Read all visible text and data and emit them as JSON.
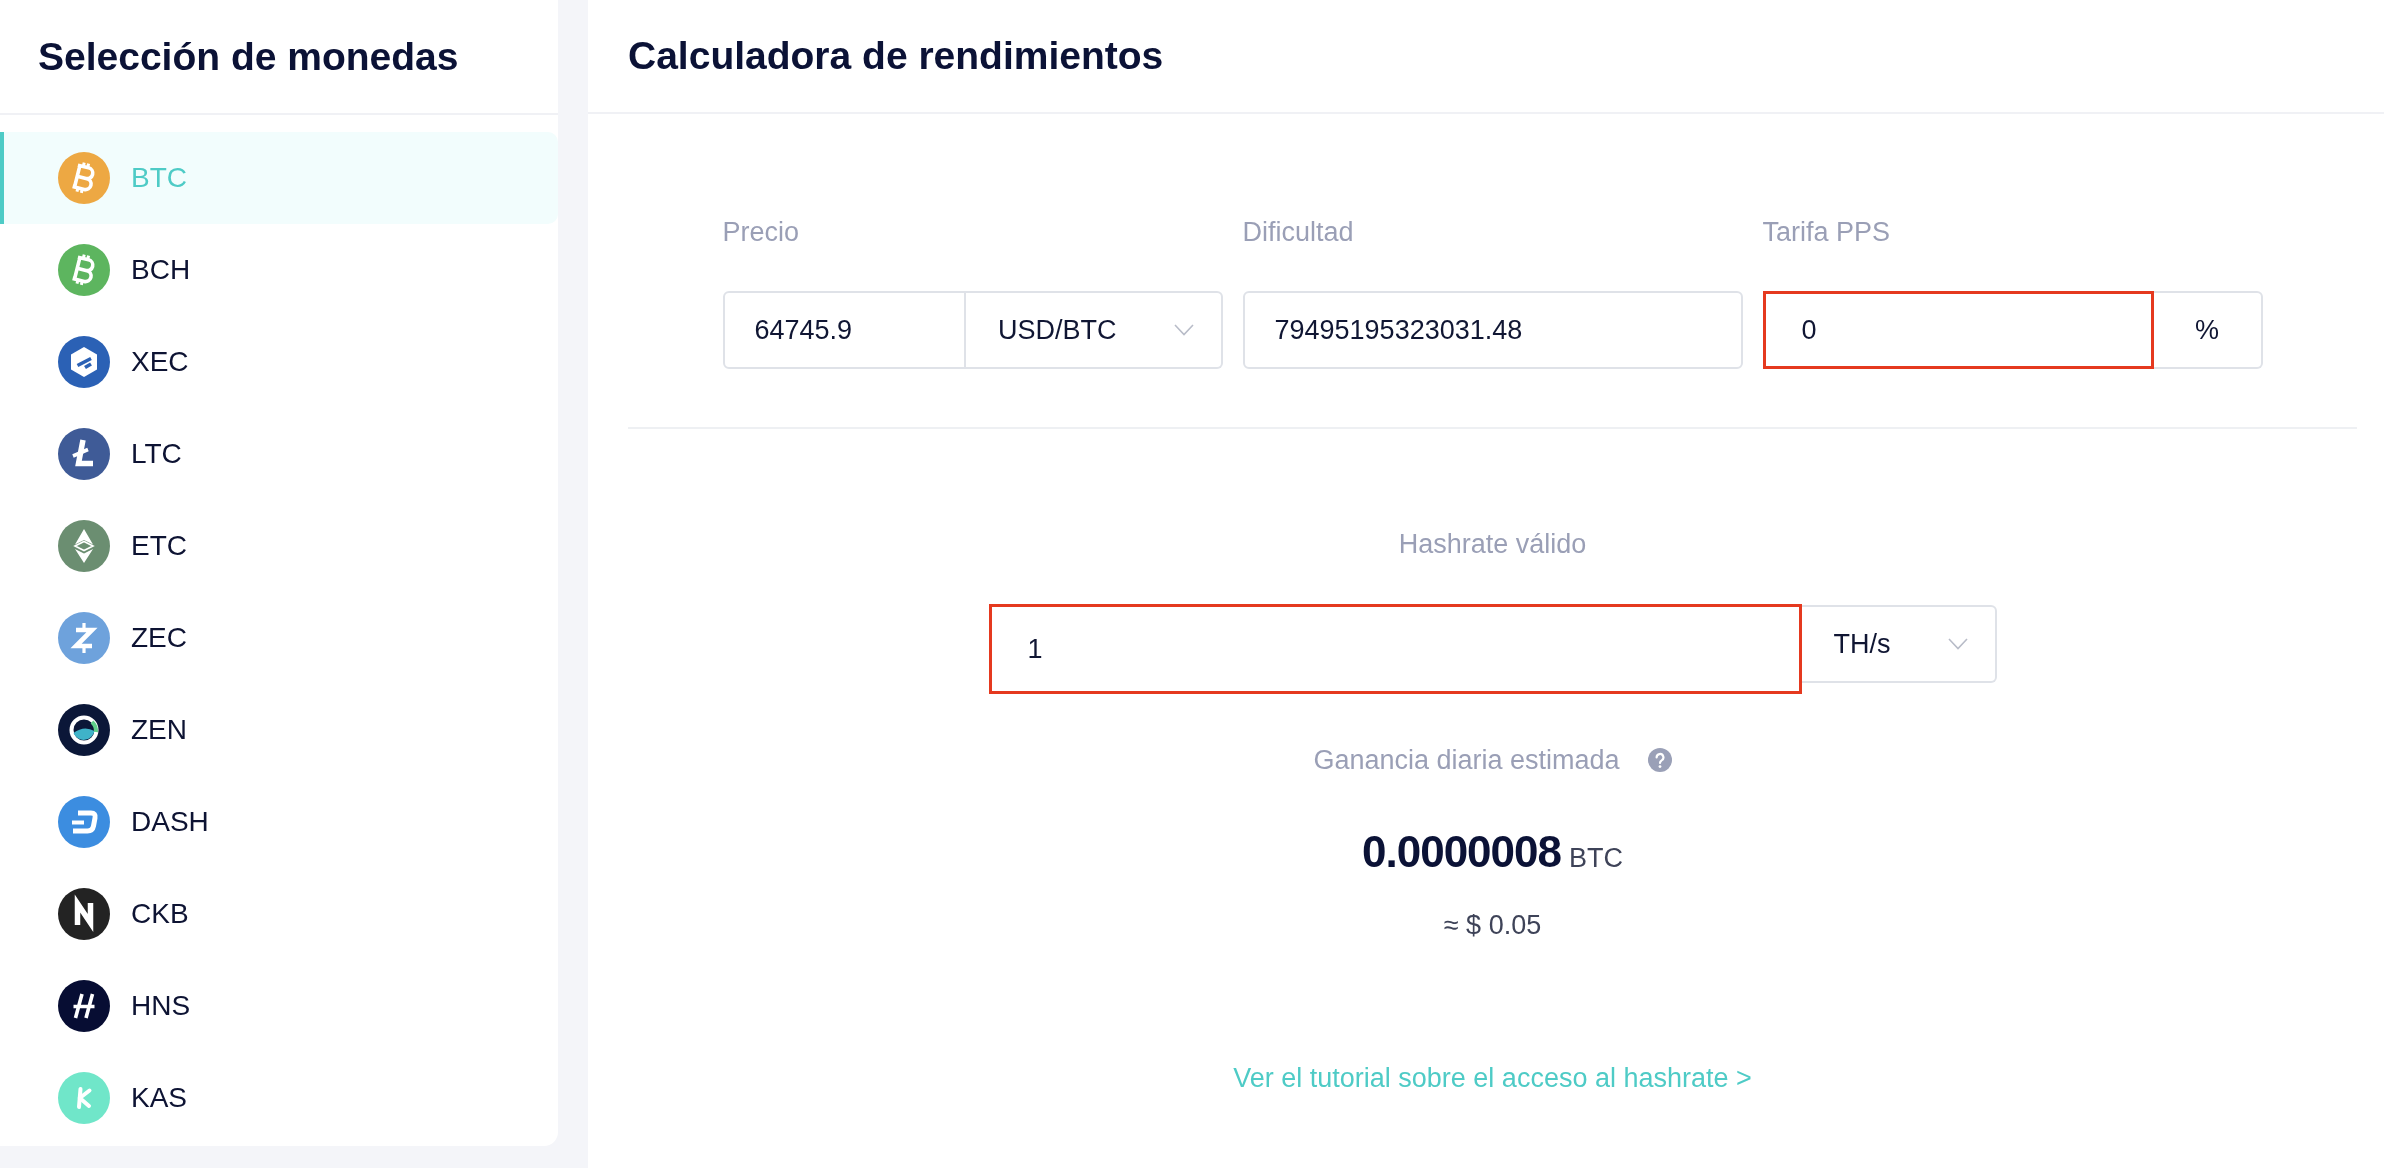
{
  "sidebar": {
    "title": "Selección de monedas",
    "coins": [
      {
        "label": "BTC",
        "selected": true,
        "kind": "b-sign",
        "color": "#eda843"
      },
      {
        "label": "BCH",
        "selected": false,
        "kind": "b-sign",
        "color": "#5db55f"
      },
      {
        "label": "XEC",
        "selected": false,
        "kind": "e-hexagon",
        "color": "#2b61b5"
      },
      {
        "label": "LTC",
        "selected": false,
        "kind": "l-sign",
        "color": "#3f5b97"
      },
      {
        "label": "ETC",
        "selected": false,
        "kind": "diamond",
        "color": "#6b8e71"
      },
      {
        "label": "ZEC",
        "selected": false,
        "kind": "z-sign",
        "color": "#6ea2dc"
      },
      {
        "label": "ZEN",
        "selected": false,
        "kind": "ring",
        "color": "#0b1738"
      },
      {
        "label": "DASH",
        "selected": false,
        "kind": "d-sign",
        "color": "#3c8de0"
      },
      {
        "label": "CKB",
        "selected": false,
        "kind": "n-block",
        "color": "#232323"
      },
      {
        "label": "HNS",
        "selected": false,
        "kind": "h-block",
        "color": "#070d33"
      },
      {
        "label": "KAS",
        "selected": false,
        "kind": "k-sign",
        "color": "#70e6c9"
      }
    ]
  },
  "calculator": {
    "title": "Calculadora de rendimientos",
    "fields": [
      {
        "label": "Precio",
        "value": "64745.9",
        "unit": "USD/BTC",
        "kind": "with-select",
        "highlighted": false
      },
      {
        "label": "Dificultad",
        "value": "79495195323031.48",
        "kind": "plain",
        "highlighted": false
      },
      {
        "label": "Tarifa PPS",
        "value": "0",
        "unit": "%",
        "kind": "with-addon",
        "highlighted": true
      }
    ],
    "hashrate": {
      "label": "Hashrate válido",
      "value": "1",
      "unit": "TH/s",
      "highlighted": true
    },
    "estimate": {
      "label": "Ganancia diaria estimada",
      "amount": "0.0000008",
      "currency": "BTC",
      "fiat": "≈ $ 0.05"
    },
    "tutorial_link": "Ver el tutorial sobre el acceso al hashrate >"
  }
}
